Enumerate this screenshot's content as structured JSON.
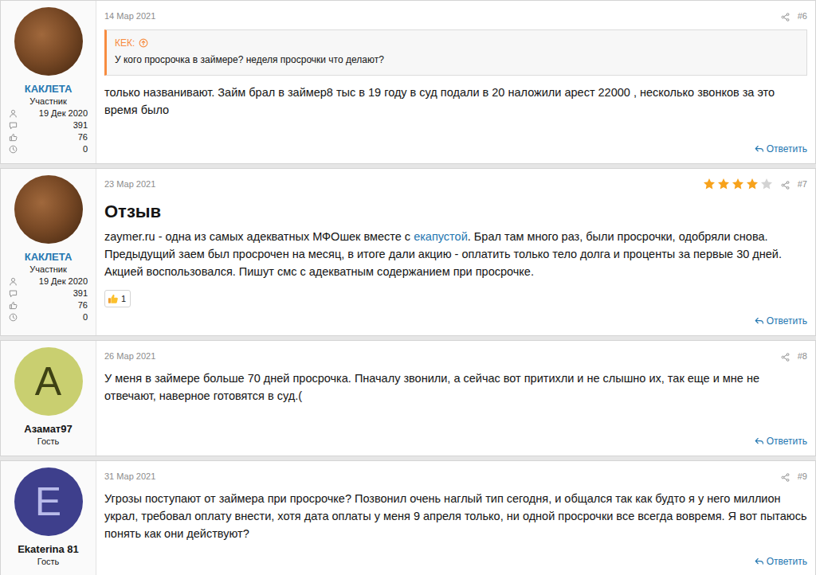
{
  "posts": [
    {
      "date": "14 Мар 2021",
      "number": "#6",
      "author": {
        "name": "КАКЛЕТА",
        "role": "Участник",
        "is_member": true,
        "avatar": {
          "kind": "photo"
        },
        "stats": [
          "19 Дек 2020",
          "391",
          "76",
          "0"
        ]
      },
      "quote": {
        "author": "КЕК:",
        "text": "У кого просрочка в займере? неделя просрочки что делают?"
      },
      "body": [
        {
          "text": "только названивают. Займ брал в займер8 тыс в 19 году в суд подали в 20 наложили арест 22000 , несколько звонков за это время было",
          "link": false
        }
      ],
      "reply": "Ответить"
    },
    {
      "date": "23 Мар 2021",
      "number": "#7",
      "stars": 4,
      "author": {
        "name": "КАКЛЕТА",
        "role": "Участник",
        "is_member": true,
        "avatar": {
          "kind": "photo"
        },
        "stats": [
          "19 Дек 2020",
          "391",
          "76",
          "0"
        ]
      },
      "title": "Отзыв",
      "body": [
        {
          "text": "zaymer.ru - одна из самых адекватных МФОшек вместе с ",
          "link": false
        },
        {
          "text": "екапустой",
          "link": true
        },
        {
          "text": ". Брал там много раз, были просрочки, одобряли снова. Предыдущий заем был просрочен на месяц, в итоге дали акцию - оплатить только тело долга и проценты за первые 30 дней. Акцией воспользовался. Пишут смс с адекватным содержанием при просрочке.",
          "link": false
        }
      ],
      "reactions": [
        {
          "count": "1"
        }
      ],
      "reply": "Ответить"
    },
    {
      "date": "26 Мар 2021",
      "number": "#8",
      "author": {
        "name": "Азамат97",
        "role": "Гость",
        "is_member": false,
        "avatar": {
          "kind": "letter",
          "letter": "A",
          "color": "#c9cf70",
          "text_color": "#3e4214"
        },
        "stats": []
      },
      "body": [
        {
          "text": "У меня в займере больше 70 дней просрочка. Пначалу звонили, а сейчас вот притихли и не слышно их, так еще и мне не отвечают, наверное готовятся в суд.(",
          "link": false
        }
      ],
      "reply": "Ответить"
    },
    {
      "date": "31 Мар 2021",
      "number": "#9",
      "author": {
        "name": "Ekaterina 81",
        "role": "Гость",
        "is_member": false,
        "avatar": {
          "kind": "letter",
          "letter": "E",
          "color": "#3e3f8c",
          "text_color": "#b9bbea"
        },
        "stats": []
      },
      "body": [
        {
          "text": "Угрозы поступают от займера при просрочке? Позвонил очень наглый тип сегодня, и общался так как будто я у него миллион украл, требовал оплату внести, хотя дата оплаты у меня 9 апреля только, ни одной просрочки все всегда вовремя. Я вот пытаюсь понять как они действуют?",
          "link": false
        }
      ],
      "reply": "Ответить"
    }
  ]
}
